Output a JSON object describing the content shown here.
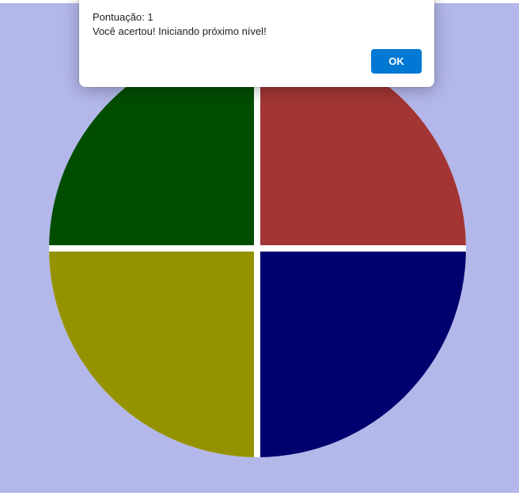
{
  "colors": {
    "page_background": "#b3b7ea",
    "overlay": "rgba(0,0,0,0.0)",
    "quadrant_top_left": "#004d00",
    "quadrant_top_right": "#a33535",
    "quadrant_bottom_left": "#959200",
    "quadrant_bottom_right": "#00006e",
    "button_background": "#0078d4"
  },
  "dialog": {
    "line1": "Pontuação: 1",
    "line2": "Você acertou! Iniciando próximo nível!",
    "ok_label": "OK"
  }
}
